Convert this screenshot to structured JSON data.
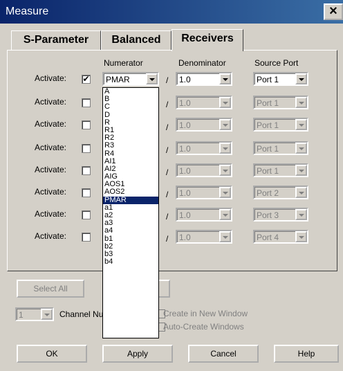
{
  "window": {
    "title": "Measure",
    "close_label": "×"
  },
  "tabs": [
    {
      "label": "S-Parameter"
    },
    {
      "label": "Balanced"
    },
    {
      "label": "Receivers"
    }
  ],
  "headers": {
    "numerator": "Numerator",
    "denominator": "Denominator",
    "source_port": "Source Port"
  },
  "row_label": "Activate:",
  "slash": "/",
  "rows": [
    {
      "checked": true,
      "check_mark": "✔",
      "numerator": "PMAR",
      "denominator": "1.0",
      "port": "Port 1"
    },
    {
      "checked": false,
      "check_mark": "",
      "numerator": "",
      "denominator": "1.0",
      "port": "Port 1"
    },
    {
      "checked": false,
      "check_mark": "",
      "numerator": "",
      "denominator": "1.0",
      "port": "Port 1"
    },
    {
      "checked": false,
      "check_mark": "",
      "numerator": "",
      "denominator": "1.0",
      "port": "Port 1"
    },
    {
      "checked": false,
      "check_mark": "",
      "numerator": "",
      "denominator": "1.0",
      "port": "Port 1"
    },
    {
      "checked": false,
      "check_mark": "",
      "numerator": "",
      "denominator": "1.0",
      "port": "Port 2"
    },
    {
      "checked": false,
      "check_mark": "",
      "numerator": "",
      "denominator": "1.0",
      "port": "Port 3"
    },
    {
      "checked": false,
      "check_mark": "",
      "numerator": "",
      "denominator": "1.0",
      "port": "Port 4"
    }
  ],
  "dropdown": {
    "items": [
      "A",
      "B",
      "C",
      "D",
      "R",
      "R1",
      "R2",
      "R3",
      "R4",
      "AI1",
      "AI2",
      "AIG",
      "AOS1",
      "AOS2",
      "PMAR",
      "a1",
      "a2",
      "a3",
      "a4",
      "b1",
      "b2",
      "b3",
      "b4"
    ],
    "selected": "PMAR"
  },
  "buttons": {
    "select_all": "Select All",
    "ok": "OK",
    "apply": "Apply",
    "cancel": "Cancel",
    "help": "Help"
  },
  "channel": {
    "value": "1",
    "label": "Channel Nu"
  },
  "options": {
    "create_new_window": "Create in New Window",
    "auto_create": "Auto-Create Windows"
  }
}
